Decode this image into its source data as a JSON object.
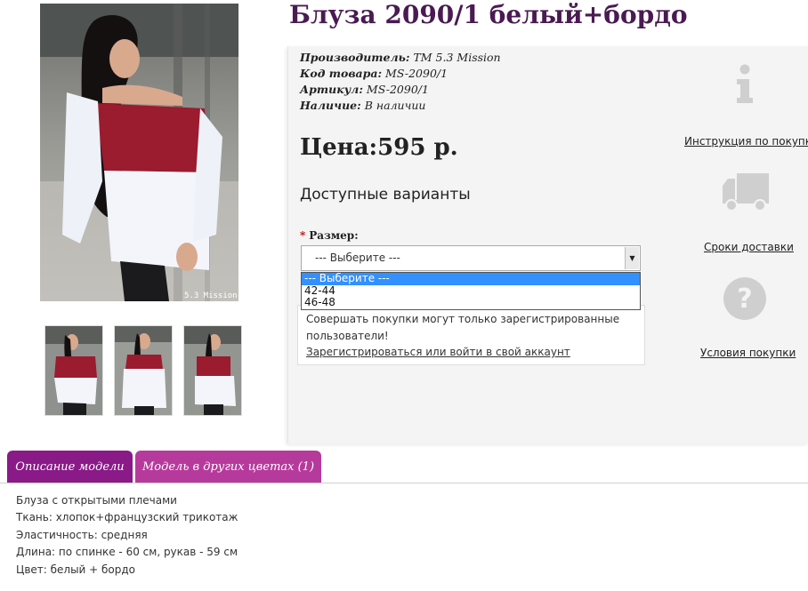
{
  "product": {
    "title": "Блуза 2090/1 белый+бордо",
    "meta": [
      {
        "label": "Производитель:",
        "value": " ТМ 5.3 Mission"
      },
      {
        "label": "Код товара:",
        "value": " MS-2090/1"
      },
      {
        "label": "Артикул:",
        "value": " MS-2090/1"
      },
      {
        "label": "Наличие:",
        "value": " В наличии"
      }
    ],
    "price": "Цена:595 р.",
    "photo_watermark": "5.3 Mission"
  },
  "options": {
    "heading": "Доступные варианты",
    "size_label": "Размер:",
    "required_mark": "*",
    "selected": "--- Выберите ---",
    "dropdown": [
      "--- Выберите ---",
      "42-44",
      "46-48"
    ]
  },
  "notice": {
    "text": "Совершать покупки могут только зарегистрированные пользователи!",
    "link": "Зарегистрироваться или войти в свой аккаунт"
  },
  "side": [
    {
      "icon": "info-icon",
      "label": "Инструкция по покупке"
    },
    {
      "icon": "truck-icon",
      "label": "Сроки доставки"
    },
    {
      "icon": "question-icon",
      "label": "Условия покупки"
    }
  ],
  "tabs": [
    {
      "label": "Описание модели",
      "active": true
    },
    {
      "label": "Модель в других цветах (1)",
      "active": false
    }
  ],
  "description": [
    "Блуза с открытыми плечами",
    "Ткань: хлопок+французский трикотаж",
    "Эластичность: средняя",
    "Длина: по спинке - 60 см, рукав - 59 см",
    "Цвет: белый + бордо"
  ],
  "colors": {
    "title": "#4a1a52",
    "tab_active": "#8a1a88",
    "tab_inactive": "#b63a9c",
    "select_highlight": "#3390ff",
    "blouse_top": "#9b1b2f",
    "blouse_bottom": "#f3f5fb"
  }
}
